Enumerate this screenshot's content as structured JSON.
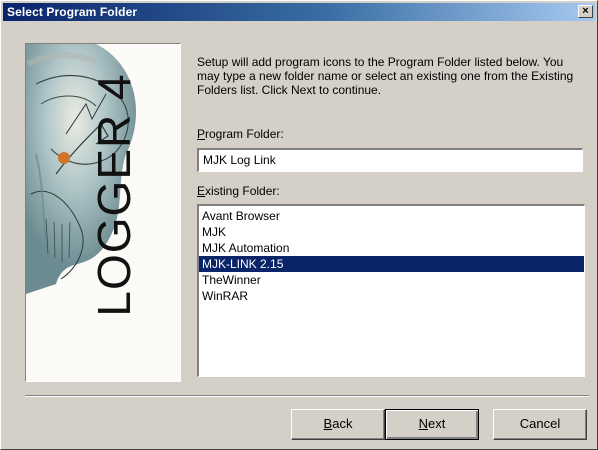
{
  "window": {
    "title": "Select Program Folder",
    "close_glyph": "×"
  },
  "banner": {
    "text": "LOGGER 4",
    "icon": "logger-artwork"
  },
  "description": "Setup will add program icons to the Program Folder listed below. You may type a new folder name or select an existing one from the Existing Folders list. Click Next to continue.",
  "program_folder": {
    "mnemonic": "P",
    "label_rest": "rogram Folder:",
    "value": "MJK Log Link"
  },
  "existing_folder": {
    "mnemonic": "E",
    "label_rest": "xisting Folder:",
    "items": [
      "Avant Browser",
      "MJK",
      "MJK Automation",
      "MJK-LINK 2.15",
      "TheWinner",
      "WinRAR"
    ],
    "selected_index": 3
  },
  "buttons": {
    "back": {
      "mnemonic": "B",
      "rest": "ack"
    },
    "next": {
      "mnemonic": "N",
      "rest": "ext"
    },
    "cancel": {
      "label": "Cancel"
    }
  },
  "colors": {
    "titlebar_start": "#0a246a",
    "selection": "#0a246a",
    "face": "#d4d0c8"
  }
}
